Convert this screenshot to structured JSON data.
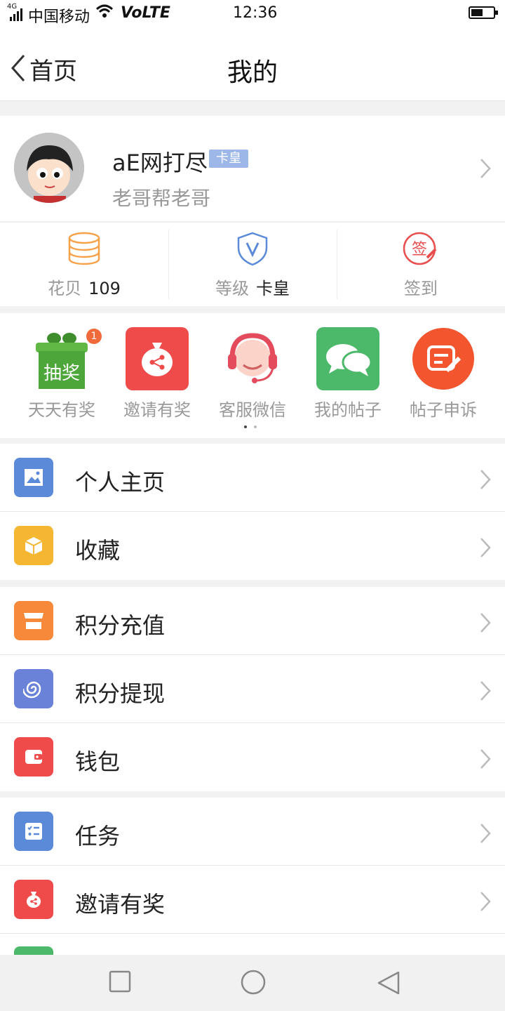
{
  "status_bar": {
    "network": "4G",
    "carrier": "中国移动",
    "volte": "VoLTE",
    "time": "12:36"
  },
  "nav": {
    "back_label": "首页",
    "title": "我的"
  },
  "profile": {
    "name": "aE网打尽",
    "badge": "卡皇",
    "signature": "老哥帮老哥"
  },
  "stats": [
    {
      "label": "花贝",
      "value": "109",
      "icon": "coins-stack-icon"
    },
    {
      "label": "等级",
      "value": "卡皇",
      "icon": "shield-v-icon"
    },
    {
      "label": "签到",
      "value": "",
      "icon": "sign-stamp-icon"
    }
  ],
  "shortcuts": [
    {
      "label": "天天有奖",
      "icon": "gift-box-icon",
      "icon_text": "抽奖",
      "badge": "1"
    },
    {
      "label": "邀请有奖",
      "icon": "money-bag-share-icon"
    },
    {
      "label": "客服微信",
      "icon": "customer-service-icon"
    },
    {
      "label": "我的帖子",
      "icon": "chat-bubbles-icon"
    },
    {
      "label": "帖子申诉",
      "icon": "edit-note-icon"
    }
  ],
  "menu_groups": [
    [
      {
        "label": "个人主页",
        "icon": "image-icon",
        "color": "#5b8ad9"
      },
      {
        "label": "收藏",
        "icon": "cube-icon",
        "color": "#f5b731"
      }
    ],
    [
      {
        "label": "积分充值",
        "icon": "store-icon",
        "color": "#f7893a"
      },
      {
        "label": "积分提现",
        "icon": "spiral-icon",
        "color": "#6a82d8"
      },
      {
        "label": "钱包",
        "icon": "wallet-icon",
        "color": "#ef4b4b"
      }
    ],
    [
      {
        "label": "任务",
        "icon": "task-list-icon",
        "color": "#5b8ad9"
      },
      {
        "label": "邀请有奖",
        "icon": "money-bag-share-icon",
        "color": "#ef4b4b"
      }
    ]
  ],
  "colors": {
    "accent_blue": "#5b8ad9",
    "coin_orange": "#f7a24a",
    "sign_red": "#e94e4e"
  }
}
